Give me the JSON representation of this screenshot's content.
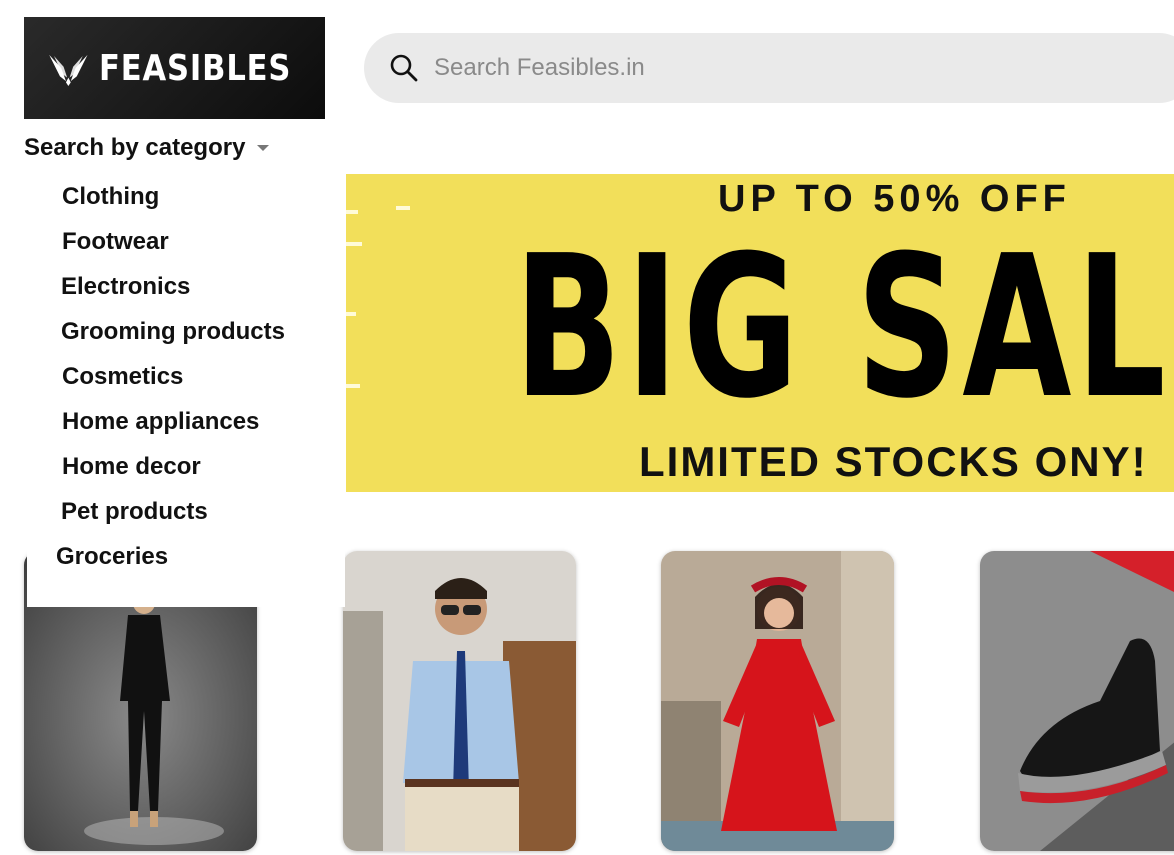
{
  "brand": {
    "name": "FEASIBLES",
    "logo_icon": "wings-logo-icon"
  },
  "search": {
    "placeholder": "Search Feasibles.in",
    "icon": "search-icon"
  },
  "category_menu": {
    "header": "Search by category",
    "items": [
      "Clothing",
      "Footwear",
      "Electronics",
      "Grooming products",
      "Cosmetics",
      "Home appliances",
      "Home decor",
      "Pet products",
      "Groceries"
    ]
  },
  "banner": {
    "top_text": "UP TO 50% OFF",
    "headline": "BIG SAL",
    "bottom_text": "LIMITED STOCKS ONY!",
    "background_color": "#f2df5a"
  },
  "products": [
    {
      "image": "woman-black-suit-photo"
    },
    {
      "image": "man-blue-shirt-sunglasses-photo"
    },
    {
      "image": "girl-red-dress-photo"
    },
    {
      "image": "black-red-sneaker-photo"
    }
  ]
}
